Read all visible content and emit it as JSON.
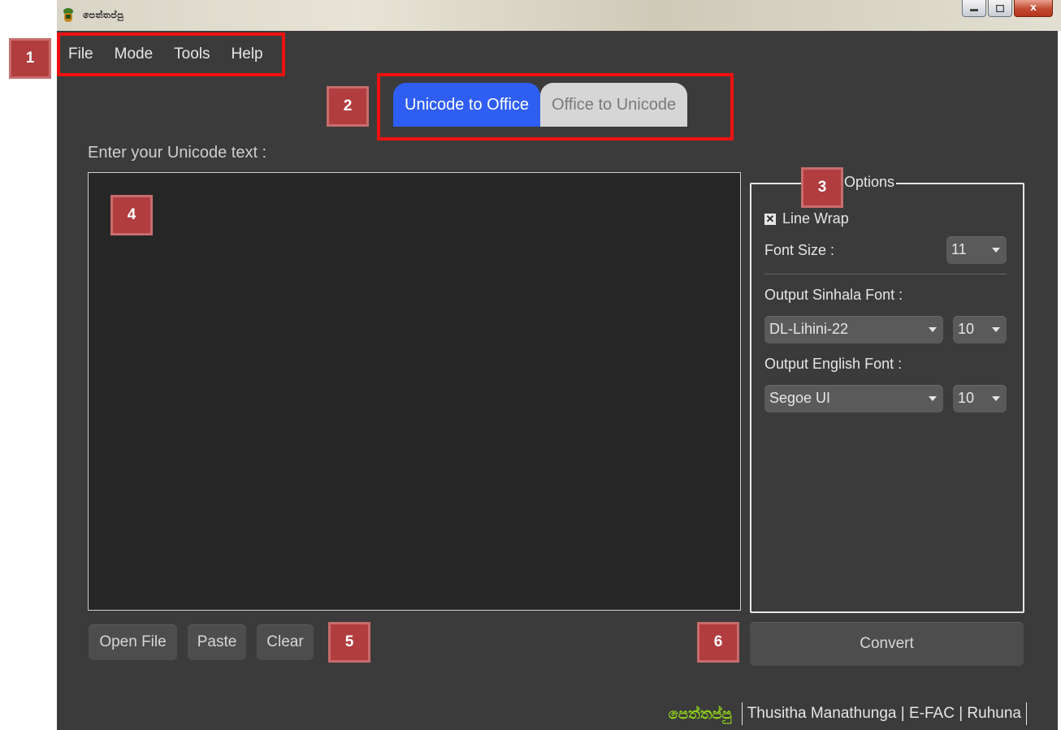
{
  "window": {
    "title": "පෙත්තප්පු",
    "minimize_icon": "minimize-icon",
    "maximize_icon": "maximize-icon",
    "close_label": "X"
  },
  "menu": {
    "items": [
      {
        "label": "File"
      },
      {
        "label": "Mode"
      },
      {
        "label": "Tools"
      },
      {
        "label": "Help"
      }
    ]
  },
  "tabs": {
    "active": "Unicode to Office",
    "inactive": "Office to Unicode",
    "active_color": "#2f5ef5"
  },
  "main": {
    "prompt": "Enter your Unicode text :",
    "text_value": ""
  },
  "options": {
    "legend": "Options",
    "line_wrap_label": "Line Wrap",
    "line_wrap_checked": true,
    "font_size_label": "Font Size :",
    "font_size_value": "11",
    "sinhala_font_label": "Output Sinhala Font :",
    "sinhala_font_value": "DL-Lihini-22",
    "sinhala_size_value": "10",
    "english_font_label": "Output English Font :",
    "english_font_value": "Segoe UI",
    "english_size_value": "10"
  },
  "buttons": {
    "open_file": "Open File",
    "paste": "Paste",
    "clear": "Clear",
    "convert": "Convert"
  },
  "footer": {
    "brand": "පෙත්තප්පු",
    "credit": "Thusitha Manathunga | E-FAC | Ruhuna",
    "brand_color": "#8fcf1a"
  },
  "annotations": [
    "1",
    "2",
    "3",
    "4",
    "5",
    "6"
  ]
}
